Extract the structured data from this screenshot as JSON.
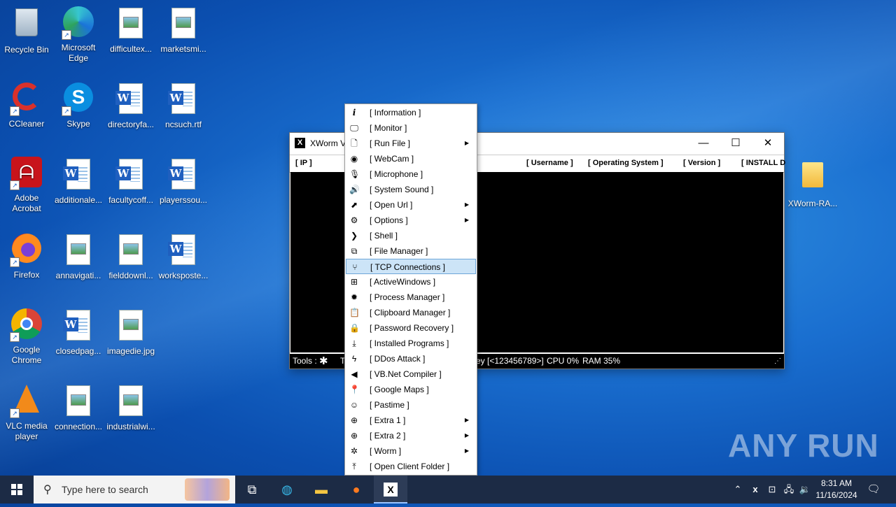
{
  "desktop": {
    "icons": [
      {
        "label": "Recycle Bin"
      },
      {
        "label": "Microsoft Edge"
      },
      {
        "label": "difficultex..."
      },
      {
        "label": "marketsmi..."
      },
      {
        "label": "CCleaner"
      },
      {
        "label": "Skype"
      },
      {
        "label": "directoryfa..."
      },
      {
        "label": "ncsuch.rtf"
      },
      {
        "label": "Adobe Acrobat"
      },
      {
        "label": "additionale..."
      },
      {
        "label": "facultycoff..."
      },
      {
        "label": "playerssou..."
      },
      {
        "label": "Firefox"
      },
      {
        "label": "annavigati..."
      },
      {
        "label": "fielddownl..."
      },
      {
        "label": "workspostе..."
      },
      {
        "label": "Google Chrome"
      },
      {
        "label": "closedpag..."
      },
      {
        "label": "imagedie.jpg"
      },
      {
        "label": "VLC media player"
      },
      {
        "label": "connection..."
      },
      {
        "label": "industrialwi..."
      },
      {
        "label": "XWorm-RA..."
      }
    ]
  },
  "window": {
    "title": "XWorm V",
    "app_icon": "X",
    "columns": [
      "[ IP ]",
      "[ Username ]",
      "[ Operating System ]",
      "[ Version ]",
      "[ INSTALL D"
    ],
    "status": {
      "tools_label": "Tools :",
      "t_label": "T",
      "key_text": "ey [<123456789>]",
      "cpu": "CPU 0%",
      "ram": "RAM 35%"
    }
  },
  "context_menu": {
    "items": [
      {
        "label": "[ Information ]",
        "icon": "info-icon",
        "submenu": false
      },
      {
        "label": "[ Monitor ]",
        "icon": "monitor-icon",
        "submenu": false
      },
      {
        "label": "[ Run File ]",
        "icon": "file-icon",
        "submenu": true
      },
      {
        "label": "[ WebCam ]",
        "icon": "webcam-icon",
        "submenu": false
      },
      {
        "label": "[ Microphone ]",
        "icon": "microphone-icon",
        "submenu": false
      },
      {
        "label": "[ System Sound ]",
        "icon": "speaker-icon",
        "submenu": false
      },
      {
        "label": "[ Open Url ]",
        "icon": "link-icon",
        "submenu": true
      },
      {
        "label": "[ Options ]",
        "icon": "gear-icon",
        "submenu": true
      },
      {
        "label": "[ Shell ]",
        "icon": "shell-icon",
        "submenu": false
      },
      {
        "label": "[ File Manager ]",
        "icon": "files-icon",
        "submenu": false
      },
      {
        "label": "[ TCP Connections ]",
        "icon": "network-icon",
        "submenu": false,
        "selected": true
      },
      {
        "label": "[ ActiveWindows ]",
        "icon": "windows-icon",
        "submenu": false
      },
      {
        "label": "[ Process Manager ]",
        "icon": "cog-icon",
        "submenu": false
      },
      {
        "label": "[ Clipboard Manager ]",
        "icon": "clipboard-icon",
        "submenu": false
      },
      {
        "label": "[ Password Recovery ]",
        "icon": "lock-icon",
        "submenu": false
      },
      {
        "label": "[ Installed Programs ]",
        "icon": "download-icon",
        "submenu": false
      },
      {
        "label": "[ DDos Attack ]",
        "icon": "bolt-icon",
        "submenu": false
      },
      {
        "label": "[ VB.Net Compiler ]",
        "icon": "code-icon",
        "submenu": false
      },
      {
        "label": "[ Google Maps ]",
        "icon": "map-pin-icon",
        "submenu": false
      },
      {
        "label": "[ Pastime ]",
        "icon": "smiley-icon",
        "submenu": false
      },
      {
        "label": "[ Extra 1 ]",
        "icon": "plus-icon",
        "submenu": true
      },
      {
        "label": "[ Extra 2 ]",
        "icon": "plus-icon",
        "submenu": true
      },
      {
        "label": "[ Worm ]",
        "icon": "bug-icon",
        "submenu": true
      },
      {
        "label": "[ Open Client Folder ]",
        "icon": "upload-icon",
        "submenu": false
      }
    ]
  },
  "watermark": "ANY RUN",
  "taskbar": {
    "search_placeholder": "Type here to search",
    "time": "8:31 AM",
    "date": "11/16/2024"
  },
  "colors": {
    "menu_highlight": "#cce4f7",
    "taskbar": "#1c2b45"
  }
}
